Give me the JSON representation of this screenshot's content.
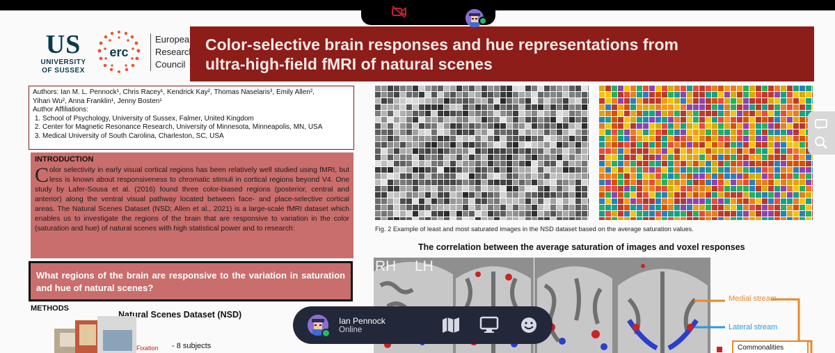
{
  "logos": {
    "us_big": "US",
    "us_line1": "UNIVERSITY",
    "us_line2": "OF SUSSEX",
    "erc_mark": "erc",
    "erc_text": [
      "European",
      "Research",
      "Council"
    ]
  },
  "banner": {
    "title": "Color-selective brain responses and hue representations from\nultra-high-field fMRI of natural scenes"
  },
  "authors": {
    "line1": "Authors: Ian M. L. Pennock¹, Chris Racey¹, Kendrick Kay², Thomas Naselaris³, Emily Allen²,",
    "line2": "Yihan Wu², Anna Franklin¹, Jenny Bosten¹",
    "affil_heading": "Author Affiliations:",
    "affiliations": [
      "School of Psychology, University of Sussex, Falmer, United Kingdom",
      "Center for Magnetic Resonance Research, University of Minnesota, Minneapolis, MN, USA",
      "Medical University of South Carolina, Charleston, SC, USA"
    ]
  },
  "intro": {
    "heading": "INTRODUCTION",
    "dropcap": "C",
    "body": "olor selectivity in early visual cortical regions has been relatively well studied using fMRI, but less is known about responsiveness to chromatic stimuli in cortical regions beyond V4. One study by Lafer-Sousa et al. (2016) found three color-biased regions (posterior, central and anterior) along the ventral visual pathway located between face- and place-selective cortical areas. The Natural Scenes Dataset (NSD; Allen et al., 2021) is a large-scale fMRI dataset which enables us to investigate the regions of the brain that are responsive to variation in the color (saturation and hue) of natural scenes with high statistical power and to research:"
  },
  "question": "What regions of the brain are responsive to the variation in saturation and hue of natural scenes?",
  "methods": {
    "heading": "METHODS",
    "nsd_heading": "Natural Scenes Dataset (NSD)",
    "fixation": "Fixation",
    "subjects": "- 8 subjects"
  },
  "figure2": {
    "caption": "Fig. 2 Example of least and most saturated images in the NSD dataset based on the average saturation values."
  },
  "correlation": {
    "title": "The correlation between the average saturation of images and voxel responses",
    "rh": "RH",
    "lh": "LH",
    "medial": "Medial stream",
    "lateral": "Lateral stream",
    "common": "Commonalities"
  },
  "call": {
    "name": "Ian Pennock",
    "status": "Online",
    "colors": {
      "pill_bg": "#23273a",
      "online": "#1fbf5f",
      "cam_off": "#c0242c"
    }
  },
  "colors": {
    "banner": "#8c1d19",
    "intro_bg": "#c96e6c",
    "accent_orange": "#e8892e",
    "accent_blue": "#2a9ad8"
  }
}
